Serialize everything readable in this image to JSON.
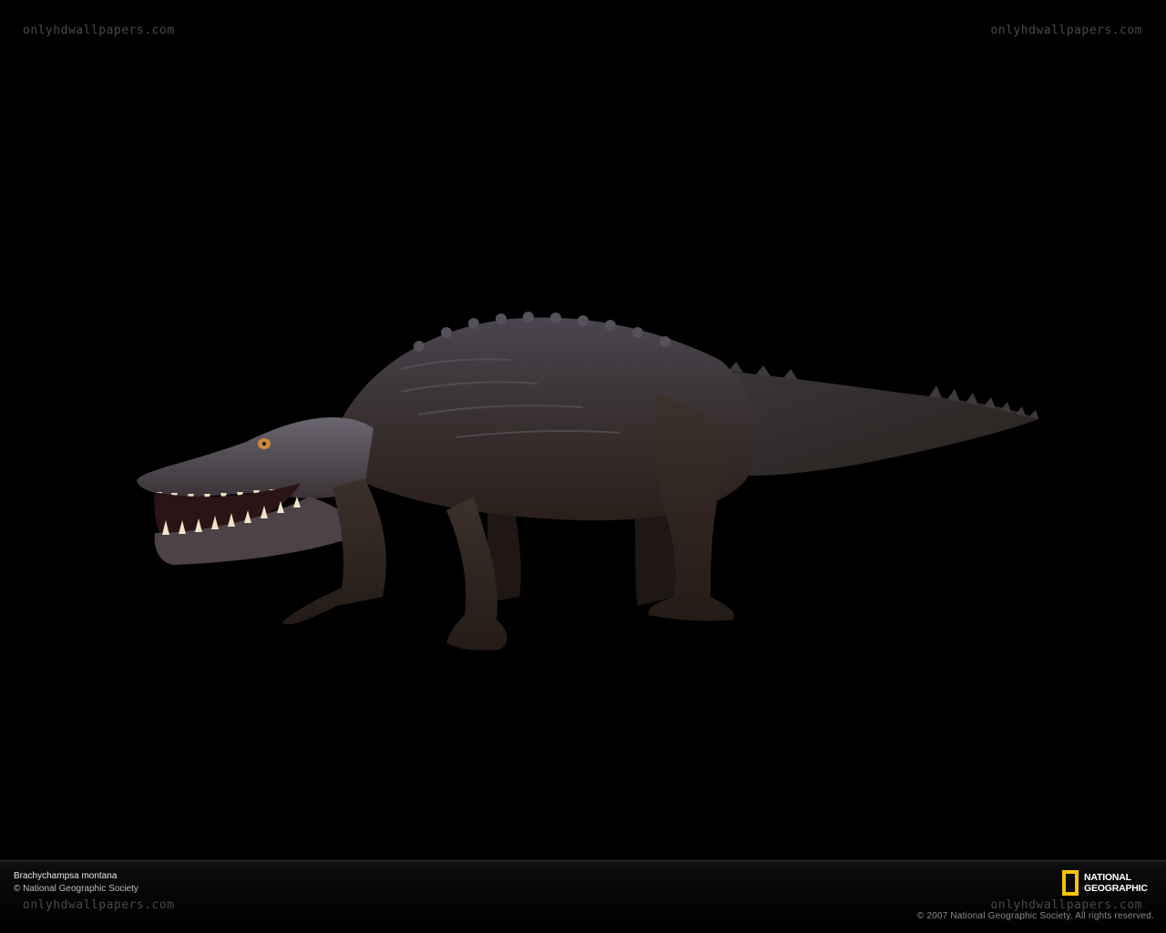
{
  "watermarks": {
    "top_left": "onlyhdwallpapers.com",
    "top_right": "onlyhdwallpapers.com",
    "bottom_left": "onlyhdwallpapers.com",
    "bottom_right": "onlyhdwallpapers.com"
  },
  "subject": {
    "icon": "crocodilian-illustration"
  },
  "footer": {
    "title": "Brachychampsa montana",
    "credit": "© National Geographic Society",
    "copyright": "© 2007 National Geographic Society. All rights reserved.",
    "logo": {
      "line1": "NATIONAL",
      "line2": "GEOGRAPHIC",
      "frame_color": "#f5c400"
    }
  },
  "colors": {
    "background": "#000000"
  }
}
